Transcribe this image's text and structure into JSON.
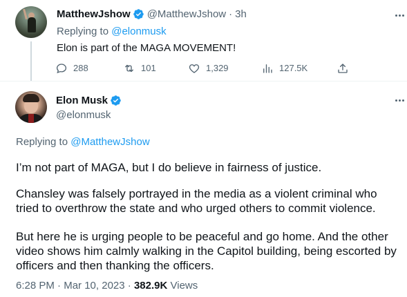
{
  "reply_tweet": {
    "author_name": "MatthewJshow",
    "author_handle": "@MatthewJshow",
    "separator": "·",
    "time_ago": "3h",
    "replying_label": "Replying to",
    "replying_handle": "@elonmusk",
    "text": "Elon is part of the MAGA MOVEMENT!",
    "stats": {
      "replies": "288",
      "retweets": "101",
      "likes": "1,329",
      "views": "127.5K"
    }
  },
  "main_tweet": {
    "author_name": "Elon Musk",
    "author_handle": "@elonmusk",
    "replying_label": "Replying to",
    "replying_handle": "@MatthewJshow",
    "paragraphs": [
      "I’m not part of MAGA, but I do believe in fairness of justice.",
      "Chansley was falsely portrayed in the media as a violent criminal who tried to overthrow the state and who urged others to commit violence.",
      "But here he is urging people to be peaceful and go home. And the other video shows him calmly walking in the Capitol building, being escorted by officers and then thanking the officers."
    ],
    "time": "6:28 PM",
    "separator": "·",
    "date": "Mar 10, 2023",
    "separator2": "·",
    "views_count": "382.9K",
    "views_label": "Views"
  },
  "colors": {
    "accent": "#1d9bf0",
    "text_primary": "#0f1419",
    "text_secondary": "#536471",
    "divider": "#eff3f4"
  },
  "icons": {
    "verified": "verified-badge-icon",
    "reply": "comment-icon",
    "retweet": "retweet-icon",
    "like": "heart-icon",
    "views": "bar-chart-icon",
    "share": "share-icon",
    "more": "more-horizontal-icon"
  }
}
